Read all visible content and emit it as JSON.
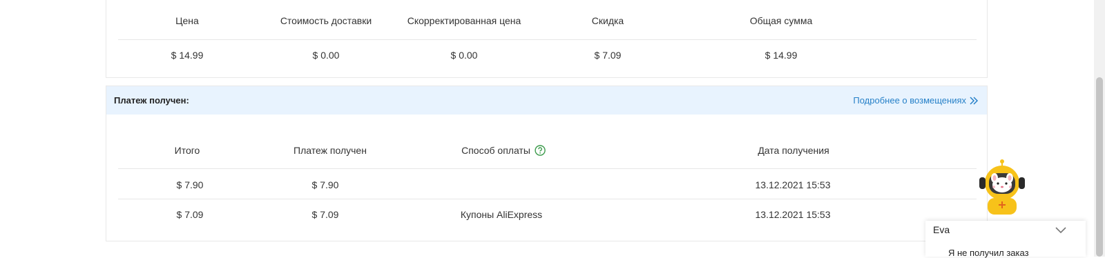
{
  "pricing": {
    "headers": [
      "Цена",
      "Стоимость доставки",
      "Скорректированная цена",
      "Скидка",
      "Общая сумма"
    ],
    "values": [
      "$ 14.99",
      "$ 0.00",
      "$ 0.00",
      "$ 7.09",
      "$ 14.99"
    ]
  },
  "payment": {
    "title": "Платеж получен:",
    "link_label": "Подробнее о возмещениях",
    "headers": {
      "total": "Итого",
      "received": "Платеж получен",
      "method": "Способ оплаты",
      "date": "Дата получения"
    },
    "rows": [
      {
        "total": "$ 7.90",
        "received": "$ 7.90",
        "method": "",
        "date": "13.12.2021 15:53"
      },
      {
        "total": "$ 7.09",
        "received": "$ 7.09",
        "method": "Купоны AliExpress",
        "date": "13.12.2021 15:53"
      }
    ]
  },
  "chat": {
    "agent_name": "Eva",
    "message": "Я не получил заказ"
  },
  "colors": {
    "accent_link": "#2680c8",
    "header_bg": "#e8f3fe",
    "help_icon": "#3a9a4a",
    "mascot_yellow": "#f7c21a"
  },
  "icons": [
    "help-circle-icon",
    "double-chevron-right-icon",
    "chevron-down-icon",
    "mascot-avatar-icon"
  ]
}
